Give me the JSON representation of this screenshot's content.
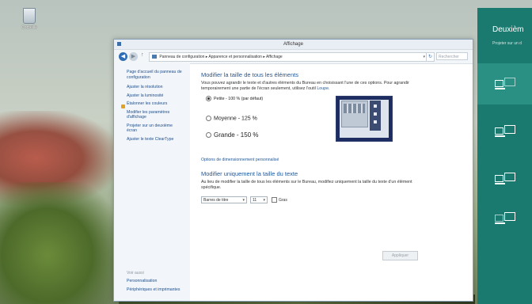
{
  "desktop": {
    "recycle_label": "Corbeille"
  },
  "window": {
    "title": "Affichage",
    "address": "Panneau de configuration  ▸  Apparence et personnalisation  ▸  Affichage",
    "search_placeholder": "Rechercher"
  },
  "sidebar": {
    "home": "Page d'accueil du panneau de configuration",
    "items": [
      "Ajuster la résolution",
      "Ajuster la luminosité",
      "Étalonner les couleurs",
      "Modifier les paramètres d'affichage",
      "Projeter sur un deuxième écran",
      "Ajuster le texte ClearType"
    ],
    "see_also": "Voir aussi",
    "bottom": [
      "Personnalisation",
      "Périphériques et imprimantes"
    ]
  },
  "main": {
    "h1": "Modifier la taille de tous les éléments",
    "p1": "Vous pouvez agrandir le texte et d'autres éléments du Bureau en choisissant l'une de ces options. Pour agrandir temporairement une partie de l'écran seulement, utilisez l'outil",
    "p1_link": "Loupe.",
    "options": [
      {
        "label": "Petite - 100 % (par défaut)",
        "selected": true
      },
      {
        "label": "Moyenne - 125 %",
        "selected": false
      },
      {
        "label": "Grande - 150 %",
        "selected": false
      }
    ],
    "custom_link": "Options de dimensionnement personnalisé",
    "h2": "Modifier uniquement la taille du texte",
    "p2": "Au lieu de modifier la taille de tous les éléments sur le Bureau, modifiez uniquement la taille du texte d'un élément spécifique.",
    "element_select": "Barres de titre",
    "size_select": "11",
    "bold_label": "Gras",
    "apply": "Appliquer"
  },
  "charm": {
    "title": "Deuxièm",
    "subtitle": "Projeter sur un d"
  }
}
